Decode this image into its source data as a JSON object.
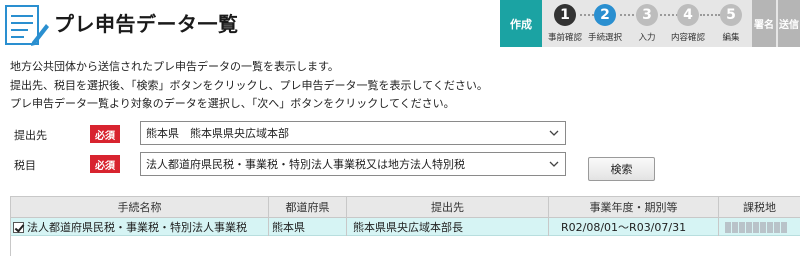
{
  "header": {
    "title": "プレ申告データ一覧"
  },
  "stepper": {
    "current_label": "作成",
    "steps": [
      {
        "number": "1",
        "label": "事前確認",
        "color": "#333333"
      },
      {
        "number": "2",
        "label": "手続選択",
        "color": "#2a8fd0"
      },
      {
        "number": "3",
        "label": "入力",
        "color": "#bdbdbd"
      },
      {
        "number": "4",
        "label": "内容確認",
        "color": "#bdbdbd"
      },
      {
        "number": "5",
        "label": "編集",
        "color": "#bdbdbd"
      }
    ],
    "sign_label": "署名",
    "send_label": "送信"
  },
  "instructions": [
    "地方公共団体から送信されたプレ申告データの一覧を表示します。",
    "提出先、税目を選択後、「検索」ボタンをクリックし、プレ申告データ一覧を表示してください。",
    "プレ申告データ一覧より対象のデータを選択し、「次へ」ボタンをクリックしてください。"
  ],
  "form": {
    "submit_to": {
      "label": "提出先",
      "required": "必須",
      "value": "熊本県　熊本県県央広域本部"
    },
    "tax_item": {
      "label": "税目",
      "required": "必須",
      "value": "法人都道府県民税・事業税・特別法人事業税又は地方法人特別税"
    },
    "search_label": "検索"
  },
  "table": {
    "columns": [
      "手続名称",
      "都道府県",
      "提出先",
      "事業年度・期別等",
      "課税地"
    ],
    "rows": [
      {
        "procedure": "法人都道府県民税・事業税・特別法人事業税",
        "prefecture": "熊本県",
        "submit_to": "熊本県県央広域本部長",
        "period": "R02/08/01～R03/07/31",
        "taxation_place": ""
      }
    ]
  },
  "colors": {
    "accent": "#1ba3a3",
    "required": "#d8232f",
    "row_selected": "#d6f4f4"
  }
}
